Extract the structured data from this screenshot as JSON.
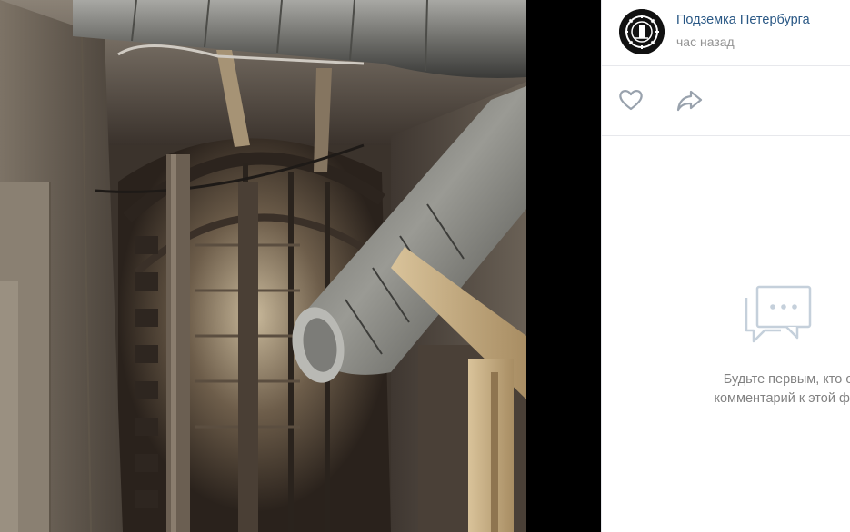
{
  "post": {
    "author_name": "Подземка Петербурга",
    "time": "час назад"
  },
  "actions": {
    "like_icon": "heart-icon",
    "share_icon": "share-arrow-icon"
  },
  "comments": {
    "empty_icon": "comments-bubble-icon",
    "empty_line1": "Будьте первым, кто оста",
    "empty_line2": "комментарий к этой фотогр"
  },
  "colors": {
    "link": "#2a5885",
    "muted": "#939393",
    "empty_text": "#828282",
    "icon_gray": "#99a2ad",
    "icon_light": "#c5d0db",
    "divider": "#e7e8ec"
  }
}
